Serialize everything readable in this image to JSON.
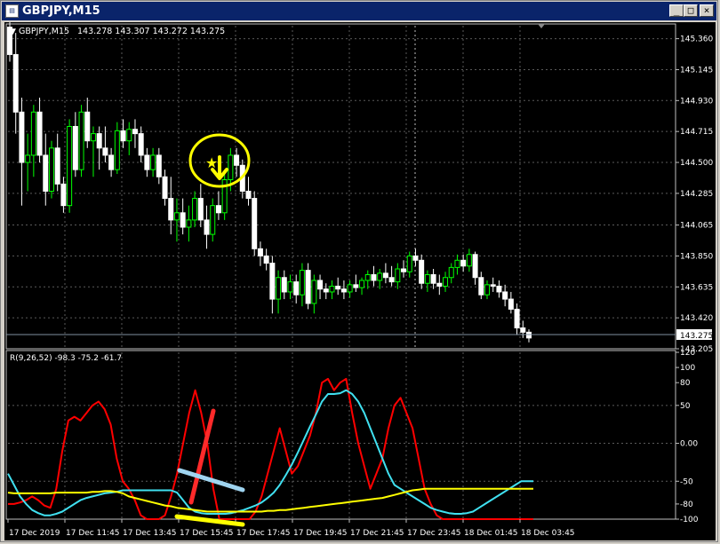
{
  "window": {
    "title": "GBPJPY,M15",
    "icon": "chart-window-icon",
    "buttons": {
      "minimize": "_",
      "maximize": "□",
      "close": "×"
    }
  },
  "main_pane": {
    "header_symbol": "GBPJPY,M15",
    "header_ohlc": "143.278 143.307 143.272 143.275",
    "current_price_label": "143.275",
    "price_ticks": [
      "145.360",
      "145.145",
      "144.930",
      "144.715",
      "144.500",
      "144.285",
      "144.065",
      "143.850",
      "143.635",
      "143.420",
      "143.205"
    ]
  },
  "indicator_pane": {
    "label": "R(9,26,52) -98.3 -75.2 -61.7",
    "ticks": [
      "120",
      "100",
      "80",
      "50",
      "0.00",
      "-50",
      "-80",
      "-100"
    ]
  },
  "time_labels": [
    "17 Dec 2019",
    "17 Dec 11:45",
    "17 Dec 13:45",
    "17 Dec 15:45",
    "17 Dec 17:45",
    "17 Dec 19:45",
    "17 Dec 21:45",
    "17 Dec 23:45",
    "18 Dec 01:45",
    "18 Dec 03:45"
  ],
  "colors": {
    "bull_candle": "#00ff00",
    "bear_candle": "#ffffff",
    "fast_line": "#ff0000",
    "mid_line": "#40e0f0",
    "slow_line": "#ffff00",
    "grid": "#5a5a5a",
    "annotation_circle": "#ffff00",
    "annotation_red": "#ff2a2a",
    "annotation_blue": "#9fd4f0"
  },
  "chart_data": {
    "type": "candlestick",
    "ylim": [
      143.205,
      145.45
    ],
    "candles_ohlc": [
      [
        145.44,
        145.5,
        145.2,
        145.25
      ],
      [
        145.25,
        145.4,
        144.7,
        144.85
      ],
      [
        144.85,
        144.95,
        144.2,
        144.5
      ],
      [
        144.5,
        144.7,
        144.3,
        144.55
      ],
      [
        144.55,
        144.9,
        144.4,
        144.85
      ],
      [
        144.85,
        144.95,
        144.5,
        144.55
      ],
      [
        144.55,
        144.7,
        144.2,
        144.3
      ],
      [
        144.3,
        144.65,
        144.25,
        144.6
      ],
      [
        144.6,
        144.7,
        144.3,
        144.35
      ],
      [
        144.35,
        144.4,
        144.15,
        144.2
      ],
      [
        144.2,
        144.8,
        144.15,
        144.75
      ],
      [
        144.75,
        144.85,
        144.4,
        144.45
      ],
      [
        144.45,
        144.9,
        144.4,
        144.85
      ],
      [
        144.85,
        144.95,
        144.6,
        144.65
      ],
      [
        144.65,
        144.75,
        144.4,
        144.7
      ],
      [
        144.7,
        144.75,
        144.45,
        144.6
      ],
      [
        144.6,
        144.75,
        144.5,
        144.55
      ],
      [
        144.55,
        144.6,
        144.4,
        144.45
      ],
      [
        144.45,
        144.78,
        144.42,
        144.72
      ],
      [
        144.72,
        144.8,
        144.6,
        144.65
      ],
      [
        144.65,
        144.78,
        144.55,
        144.73
      ],
      [
        144.73,
        144.8,
        144.6,
        144.7
      ],
      [
        144.7,
        144.75,
        144.5,
        144.55
      ],
      [
        144.55,
        144.6,
        144.4,
        144.45
      ],
      [
        144.45,
        144.6,
        144.4,
        144.55
      ],
      [
        144.55,
        144.6,
        144.35,
        144.4
      ],
      [
        144.4,
        144.45,
        144.2,
        144.25
      ],
      [
        144.25,
        144.4,
        144.0,
        144.1
      ],
      [
        144.1,
        144.25,
        143.95,
        144.15
      ],
      [
        144.15,
        144.25,
        144.0,
        144.05
      ],
      [
        144.05,
        144.2,
        143.95,
        144.1
      ],
      [
        144.1,
        144.3,
        144.05,
        144.25
      ],
      [
        144.25,
        144.35,
        144.05,
        144.1
      ],
      [
        144.1,
        144.2,
        143.9,
        144.0
      ],
      [
        144.0,
        144.25,
        143.95,
        144.2
      ],
      [
        144.2,
        144.3,
        144.1,
        144.15
      ],
      [
        144.15,
        144.45,
        144.1,
        144.38
      ],
      [
        144.38,
        144.6,
        144.3,
        144.55
      ],
      [
        144.55,
        144.6,
        144.4,
        144.48
      ],
      [
        144.48,
        144.52,
        144.25,
        144.3
      ],
      [
        144.3,
        144.4,
        144.2,
        144.25
      ],
      [
        144.25,
        144.3,
        143.85,
        143.9
      ],
      [
        143.9,
        143.95,
        143.78,
        143.85
      ],
      [
        143.85,
        143.9,
        143.75,
        143.8
      ],
      [
        143.8,
        143.85,
        143.45,
        143.55
      ],
      [
        143.55,
        143.75,
        143.45,
        143.7
      ],
      [
        143.7,
        143.75,
        143.55,
        143.6
      ],
      [
        143.6,
        143.72,
        143.55,
        143.67
      ],
      [
        143.67,
        143.72,
        143.52,
        143.58
      ],
      [
        143.58,
        143.8,
        143.5,
        143.75
      ],
      [
        143.75,
        143.8,
        143.48,
        143.52
      ],
      [
        143.52,
        143.72,
        143.45,
        143.68
      ],
      [
        143.68,
        143.72,
        143.55,
        143.62
      ],
      [
        143.62,
        143.66,
        143.55,
        143.6
      ],
      [
        143.6,
        143.68,
        143.55,
        143.64
      ],
      [
        143.64,
        143.7,
        143.58,
        143.62
      ],
      [
        143.62,
        143.68,
        143.55,
        143.6
      ],
      [
        143.6,
        143.68,
        143.56,
        143.65
      ],
      [
        143.65,
        143.72,
        143.6,
        143.63
      ],
      [
        143.63,
        143.7,
        143.58,
        143.68
      ],
      [
        143.68,
        143.75,
        143.62,
        143.72
      ],
      [
        143.72,
        143.78,
        143.64,
        143.68
      ],
      [
        143.68,
        143.76,
        143.62,
        143.73
      ],
      [
        143.73,
        143.8,
        143.66,
        143.7
      ],
      [
        143.7,
        143.78,
        143.64,
        143.67
      ],
      [
        143.67,
        143.8,
        143.62,
        143.76
      ],
      [
        143.76,
        143.82,
        143.7,
        143.74
      ],
      [
        143.74,
        143.88,
        143.7,
        143.85
      ],
      [
        143.85,
        143.9,
        143.78,
        143.82
      ],
      [
        143.82,
        143.86,
        143.62,
        143.66
      ],
      [
        143.66,
        143.75,
        143.6,
        143.72
      ],
      [
        143.72,
        143.76,
        143.62,
        143.66
      ],
      [
        143.66,
        143.72,
        143.58,
        143.64
      ],
      [
        143.64,
        143.74,
        143.6,
        143.7
      ],
      [
        143.7,
        143.8,
        143.66,
        143.77
      ],
      [
        143.77,
        143.86,
        143.72,
        143.82
      ],
      [
        143.82,
        143.86,
        143.74,
        143.78
      ],
      [
        143.78,
        143.9,
        143.74,
        143.86
      ],
      [
        143.86,
        143.88,
        143.65,
        143.7
      ],
      [
        143.7,
        143.74,
        143.55,
        143.58
      ],
      [
        143.58,
        143.68,
        143.55,
        143.65
      ],
      [
        143.65,
        143.7,
        143.6,
        143.64
      ],
      [
        143.64,
        143.68,
        143.56,
        143.6
      ],
      [
        143.6,
        143.65,
        143.5,
        143.55
      ],
      [
        143.55,
        143.6,
        143.45,
        143.48
      ],
      [
        143.48,
        143.52,
        143.3,
        143.35
      ],
      [
        143.35,
        143.4,
        143.28,
        143.32
      ],
      [
        143.32,
        143.34,
        143.25,
        143.28
      ]
    ],
    "indicator_ylim": [
      -100,
      120
    ],
    "series": [
      {
        "values": [
          -80,
          -80,
          -78,
          -75,
          -70,
          -75,
          -82,
          -85,
          -60,
          -10,
          30,
          35,
          30,
          40,
          50,
          55,
          45,
          25,
          -20,
          -50,
          -60,
          -75,
          -95,
          -100,
          -100,
          -100,
          -95,
          -70,
          -40,
          0,
          40,
          70,
          40,
          0,
          -60,
          -100,
          -100,
          -100,
          -100,
          -100,
          -100,
          -90,
          -70,
          -40,
          -10,
          20,
          -10,
          -40,
          -30,
          -10,
          10,
          40,
          80,
          85,
          70,
          80,
          85,
          40,
          0,
          -30,
          -60,
          -40,
          -20,
          20,
          50,
          60,
          40,
          20,
          -20,
          -60,
          -80,
          -95,
          -100,
          -100,
          -100,
          -100,
          -100,
          -100,
          -100,
          -100,
          -100,
          -100,
          -100,
          -100,
          -100,
          -100,
          -100,
          -100
        ]
      },
      {
        "values": [
          -40,
          -55,
          -70,
          -80,
          -88,
          -92,
          -95,
          -95,
          -93,
          -90,
          -85,
          -80,
          -75,
          -72,
          -70,
          -68,
          -66,
          -65,
          -64,
          -62,
          -62,
          -62,
          -62,
          -62,
          -62,
          -62,
          -62,
          -62,
          -65,
          -75,
          -85,
          -90,
          -92,
          -93,
          -93,
          -93,
          -93,
          -92,
          -90,
          -88,
          -85,
          -82,
          -78,
          -72,
          -65,
          -55,
          -42,
          -28,
          -12,
          5,
          22,
          38,
          55,
          65,
          65,
          66,
          70,
          65,
          55,
          40,
          20,
          0,
          -20,
          -40,
          -55,
          -60,
          -65,
          -70,
          -75,
          -80,
          -85,
          -88,
          -90,
          -92,
          -93,
          -93,
          -92,
          -90,
          -85,
          -80,
          -75,
          -70,
          -65,
          -60,
          -55,
          -50,
          -50,
          -50
        ]
      },
      {
        "values": [
          -65,
          -66,
          -66,
          -66,
          -66,
          -66,
          -66,
          -66,
          -65,
          -65,
          -65,
          -65,
          -65,
          -65,
          -64,
          -64,
          -63,
          -63,
          -64,
          -66,
          -70,
          -72,
          -74,
          -76,
          -78,
          -80,
          -82,
          -83,
          -85,
          -86,
          -87,
          -88,
          -89,
          -90,
          -90,
          -90,
          -90,
          -90,
          -90,
          -90,
          -90,
          -90,
          -90,
          -89,
          -89,
          -88,
          -88,
          -87,
          -86,
          -85,
          -84,
          -83,
          -82,
          -81,
          -80,
          -79,
          -78,
          -77,
          -76,
          -75,
          -74,
          -73,
          -72,
          -70,
          -68,
          -66,
          -64,
          -62,
          -61,
          -60,
          -60,
          -60,
          -60,
          -60,
          -60,
          -60,
          -60,
          -60,
          -60,
          -60,
          -60,
          -60,
          -60,
          -60,
          -60,
          -60,
          -60,
          -60
        ]
      }
    ]
  }
}
